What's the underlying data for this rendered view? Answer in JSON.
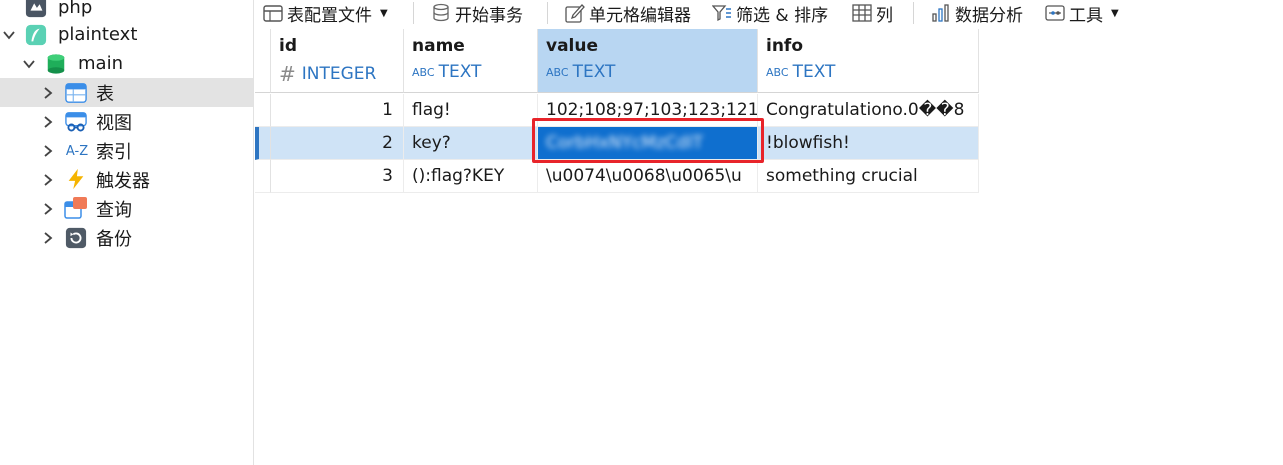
{
  "sidebar": {
    "items": [
      {
        "label": "php"
      },
      {
        "label": "plaintext"
      },
      {
        "label": "main"
      },
      {
        "label": "表"
      },
      {
        "label": "视图"
      },
      {
        "label": "索引",
        "icon_text": "A-Z"
      },
      {
        "label": "触发器"
      },
      {
        "label": "查询"
      },
      {
        "label": "备份"
      }
    ]
  },
  "toolbar": {
    "table_config": "表配置文件",
    "begin_transaction": "开始事务",
    "cell_editor": "单元格编辑器",
    "filter_sort": "筛选 & 排序",
    "columns": "列",
    "data_analysis": "数据分析",
    "tools": "工具"
  },
  "grid": {
    "columns": [
      {
        "name": "id",
        "type": "INTEGER",
        "type_icon": "#"
      },
      {
        "name": "name",
        "type": "TEXT",
        "type_icon": "ABC"
      },
      {
        "name": "value",
        "type": "TEXT",
        "type_icon": "ABC"
      },
      {
        "name": "info",
        "type": "TEXT",
        "type_icon": "ABC"
      }
    ],
    "rows": [
      {
        "id": "1",
        "name": "flag!",
        "value": "102;108;97;103;123;121",
        "info": "Congratulationo.0��8"
      },
      {
        "id": "2",
        "name": "key?",
        "value": "CorbHxNYcMzCdIT",
        "info": "!blowfish!"
      },
      {
        "id": "3",
        "name": "():flag?KEY",
        "value": "\\u0074\\u0068\\u0065\\u",
        "info": "something crucial"
      }
    ]
  },
  "colors": {
    "accent": "#2d75c2",
    "selected_cell": "#0f6fcf",
    "header_active": "#b8d6f2",
    "highlight_box": "#e8242a"
  }
}
